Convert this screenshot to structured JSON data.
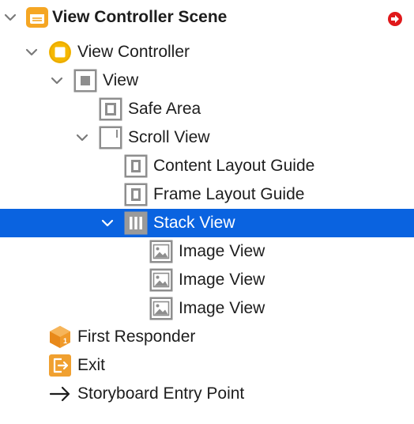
{
  "tree": {
    "scene_label": "View Controller Scene",
    "view_controller_label": "View Controller",
    "view_label": "View",
    "safe_area_label": "Safe Area",
    "scroll_view_label": "Scroll View",
    "content_layout_guide_label": "Content Layout Guide",
    "frame_layout_guide_label": "Frame Layout Guide",
    "stack_view_label": "Stack View",
    "image_views": [
      "Image View",
      "Image View",
      "Image View"
    ],
    "first_responder_label": "First Responder",
    "exit_label": "Exit",
    "storyboard_entry_point_label": "Storyboard Entry Point"
  },
  "selected_item": "Stack View",
  "colors": {
    "selection": "#0a63e0",
    "scene_icon": "#f5a623",
    "view_controller_icon": "#f5b800",
    "object_icon_gray": "#8e8e8e",
    "first_responder_icon": "#f09a2a",
    "exit_icon": "#f0a030",
    "badge_red": "#e0191b"
  }
}
